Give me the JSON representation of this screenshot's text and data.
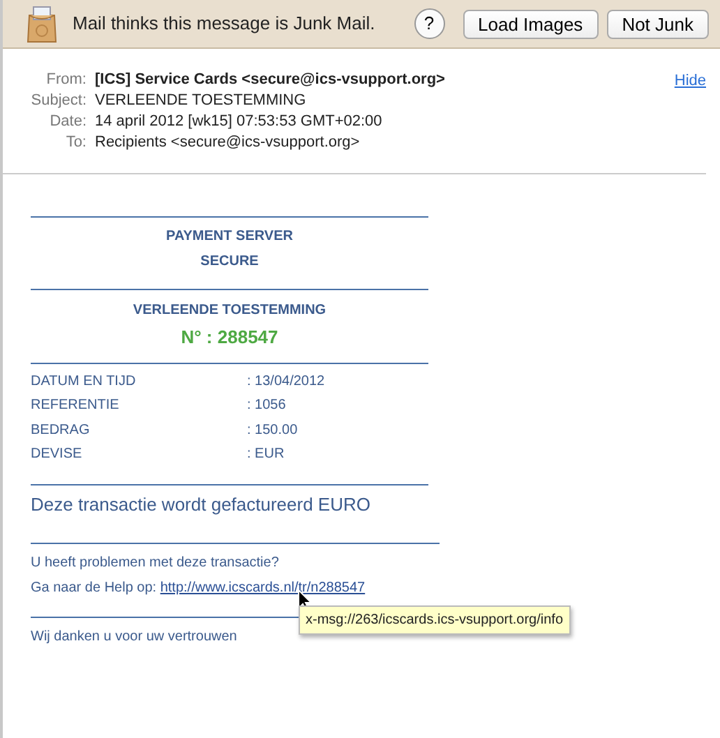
{
  "junk_bar": {
    "message": "Mail thinks this message is Junk Mail.",
    "help": "?",
    "buttons": [
      "Load Images",
      "Not Junk"
    ]
  },
  "header": {
    "fields": [
      {
        "label": "From:",
        "value": "[ICS] Service Cards <secure@ics-vsupport.org>",
        "bold": true
      },
      {
        "label": "Subject:",
        "value": "VERLEENDE TOESTEMMING",
        "bold": false
      },
      {
        "label": "Date:",
        "value": "14 april 2012 [wk15] 07:53:53 GMT+02:00",
        "bold": false
      },
      {
        "label": "To:",
        "value": "Recipients <secure@ics-vsupport.org>",
        "bold": false
      }
    ],
    "hide": "Hide"
  },
  "body": {
    "server_title": [
      "PAYMENT SERVER",
      "SECURE"
    ],
    "auth_title": "VERLEENDE TOESTEMMING",
    "auth_number": "N° : 288547",
    "details": [
      {
        "label": "DATUM EN TIJD",
        "value": ": 13/04/2012"
      },
      {
        "label": "REFERENTIE",
        "value": ": 1056"
      },
      {
        "label": "BEDRAG",
        "value": ": 150.00"
      },
      {
        "label": "DEVISE",
        "value": ": EUR"
      }
    ],
    "notice": "Deze transactie wordt gefactureerd EURO",
    "problem": "U heeft problemen met deze transactie?",
    "help_prefix": "Ga naar de Help op:",
    "help_link": "http://www.icscards.nl/tr/n288547",
    "thanks": "Wij danken u voor uw vertrouwen"
  },
  "tooltip": "x-msg://263/icscards.ics-vsupport.org/info"
}
